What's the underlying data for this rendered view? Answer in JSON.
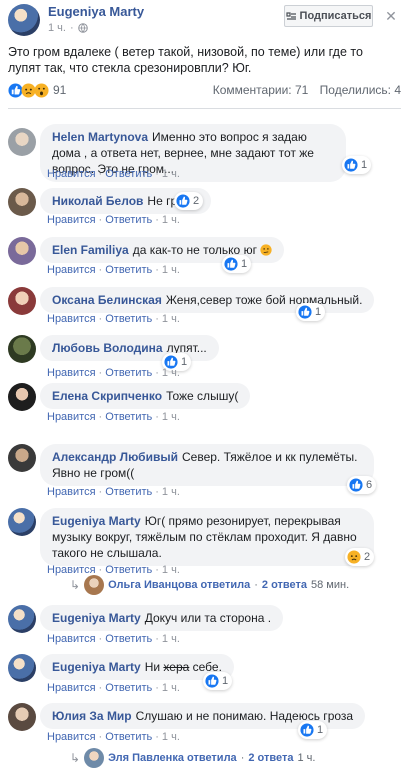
{
  "post": {
    "author": "Eugeniya Marty",
    "time": "1 ч.",
    "subscribe_label": "Подписаться",
    "more": "✕",
    "text": "Это гром вдалеке ( ветер такой, низовой, по теме) или где то лупят так, что стекла срезонировпли? Юг.",
    "reaction_count": "91",
    "comments_label": "Комментарии: 71",
    "shares_label": "Поделились: 4"
  },
  "labels": {
    "like": "Нравится",
    "reply": "Ответить"
  },
  "comments": [
    {
      "name": "Helen Martynova",
      "text": "Именно это вопрос я задаю дома , а ответа нет, вернее, мне задают тот же вопрос. Это не гром...",
      "time": "1 ч.",
      "reactions": "1"
    },
    {
      "name": "Николай Белов",
      "text": "Не гроза.",
      "time": "1 ч.",
      "reactions": "2"
    },
    {
      "name": "Elen Familiya",
      "text": "да как-то не только юг",
      "time": "1 ч.",
      "reactions": "1"
    },
    {
      "name": "Оксана Белинская",
      "text": "Женя,север тоже бой нормальный.",
      "time": "1 ч.",
      "reactions": "1"
    },
    {
      "name": "Любовь Володина",
      "text": "лупят...",
      "time": "1 ч.",
      "reactions": "1"
    },
    {
      "name": "Елена Скрипченко",
      "text": "Тоже слышу(",
      "time": "1 ч.",
      "reactions": ""
    },
    {
      "name": "Александр Любивый",
      "text": "Север. Тяжёлое и кк пулемёты. Явно не гром((",
      "time": "1 ч.",
      "reactions": "6"
    },
    {
      "name": "Eugeniya Marty",
      "text": "Юг( прямо резонирует, перекрывая музыку вокруг, тяжёлым по стёклам проходит. Я давно такого не слышала.",
      "time": "1 ч.",
      "reactions": "2"
    },
    {
      "name": "Eugeniya Marty",
      "text": "Докуч или та сторона .",
      "time": "1 ч.",
      "reactions": ""
    },
    {
      "name": "Eugeniya Marty",
      "text_a": "Ни ",
      "text_b": "хера",
      "text_c": " себе.",
      "time": "1 ч.",
      "reactions": "1"
    },
    {
      "name": "Юлия За Мир",
      "text": "Слушаю и не понимаю. Надеюсь гроза",
      "time": "1 ч.",
      "reactions": "1"
    }
  ],
  "reply_threads": [
    {
      "who": "Ольга Иванцова ответила",
      "count": "2 ответа",
      "time": "58 мин."
    },
    {
      "who": "Эля Павленка ответила",
      "count": "2 ответа",
      "time": "1 ч."
    }
  ],
  "colors": {
    "link": "#385898",
    "like_blue": "#1877f2",
    "haha_yellow": "#f7b125"
  }
}
